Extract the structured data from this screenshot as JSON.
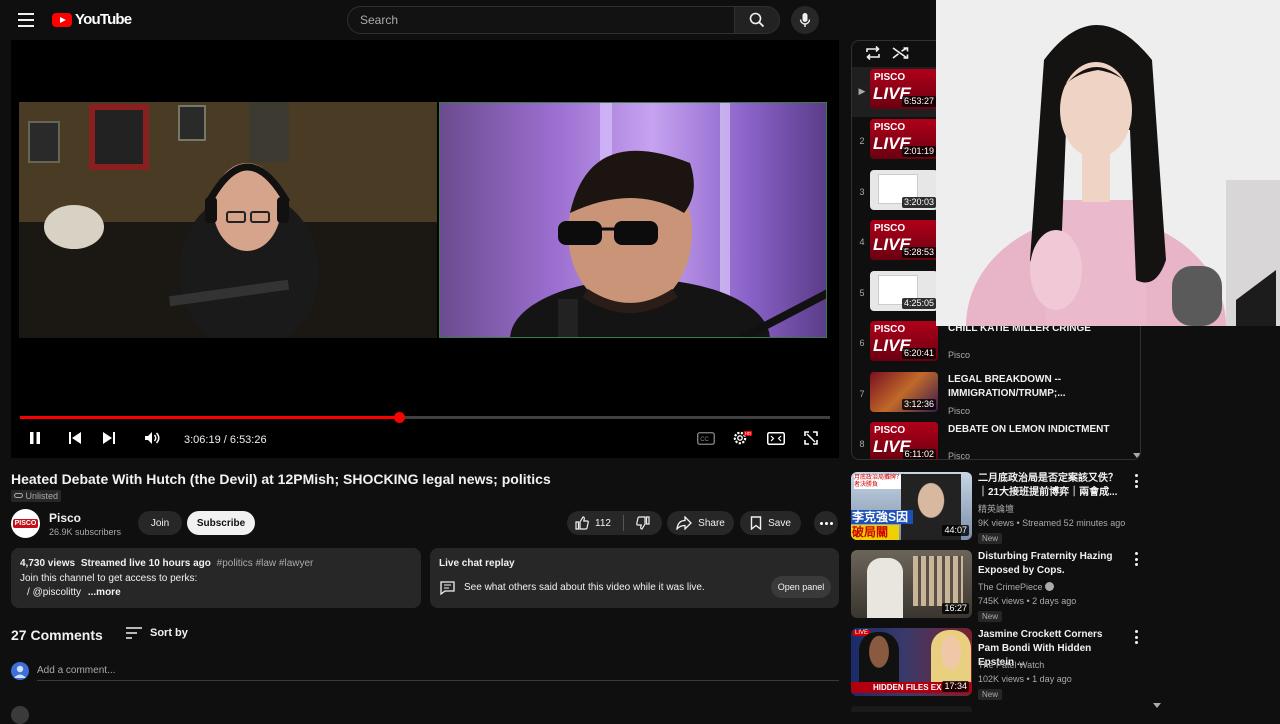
{
  "header": {
    "logo_text": "YouTube",
    "search_placeholder": "Search"
  },
  "player": {
    "current_time": "3:06:19",
    "duration": "6:53:26",
    "separator": "/",
    "progress_fraction": 0.4683
  },
  "video": {
    "title": "Heated Debate With Hutch (the Devil) at 12PMish; SHOCKING legal news; politics",
    "unlisted_label": "Unlisted",
    "channel_avatar_text": "PISCO",
    "channel_name": "Pisco",
    "subscribers": "26.9K subscribers",
    "join_label": "Join",
    "subscribe_label": "Subscribe",
    "likes": "112",
    "share_label": "Share",
    "save_label": "Save"
  },
  "description": {
    "views": "4,730 views",
    "streamed": "Streamed live 10 hours ago",
    "hashtags": "#politics #law #lawyer",
    "line1": "Join this channel to get access to perks:",
    "line2_prefix": "/",
    "line2_handle": "@piscolitty",
    "more": "...more"
  },
  "chat_replay": {
    "title": "Live chat replay",
    "text": "See what others said about this video while it was live.",
    "button": "Open panel"
  },
  "comments": {
    "count_label": "27 Comments",
    "sort_label": "Sort by",
    "add_placeholder": "Add a comment..."
  },
  "playlist": {
    "items": [
      {
        "index": "▶",
        "duration": "6:53:27",
        "thumb": "live",
        "title": "",
        "channel": ""
      },
      {
        "index": "2",
        "duration": "2:01:19",
        "thumb": "live",
        "title": "",
        "channel": ""
      },
      {
        "index": "3",
        "duration": "3:20:03",
        "thumb": "doc",
        "title": "",
        "channel": ""
      },
      {
        "index": "4",
        "duration": "5:28:53",
        "thumb": "live",
        "title": "",
        "channel": ""
      },
      {
        "index": "5",
        "duration": "4:25:05",
        "thumb": "doc",
        "title": "",
        "channel": ""
      },
      {
        "index": "6",
        "duration": "6:20:41",
        "thumb": "live",
        "title": "CHILL KATIE MILLER CRINGE",
        "channel": "Pisco"
      },
      {
        "index": "7",
        "duration": "3:12:36",
        "thumb": "legal",
        "title": "LEGAL BREAKDOWN -- IMMIGRATION/TRUMP;...",
        "channel": "Pisco"
      },
      {
        "index": "8",
        "duration": "6:11:02",
        "thumb": "live",
        "title": "DEBATE ON LEMON INDICTMENT",
        "channel": "Pisco"
      }
    ],
    "live_word_top": "PISCO",
    "live_word_bottom": "LIVE"
  },
  "recommendations": [
    {
      "title": "二月底政治局是否定案該又佚？｜21大接班提前博弈｜兩會成...",
      "channel": "精英論壇",
      "meta": "9K views • Streamed 52 minutes ago",
      "badge": "New",
      "duration": "44:07",
      "thumb_text_top": "李克強S因",
      "thumb_text_bottom": "破局關鍵",
      "thumb_caption": "月底政治局攤牌？打局者決勝負"
    },
    {
      "title": "Disturbing Fraternity Hazing Exposed by Cops.",
      "channel": "The CrimePiece",
      "meta": "745K views • 2 days ago",
      "badge": "New",
      "duration": "16:27"
    },
    {
      "title": "Jasmine Crockett Corners Pam Bondi With Hidden Epstein ...",
      "channel": "The Patel Watch",
      "meta": "102K views • 1 day ago",
      "badge": "New",
      "duration": "17:34",
      "thumb_text": "HIDDEN FILES EX",
      "thumb_live": "LIVE"
    }
  ],
  "colors": {
    "accent": "#ff0000",
    "background": "#0f0f0f",
    "surface": "#272727",
    "text_secondary": "#aaaaaa"
  }
}
